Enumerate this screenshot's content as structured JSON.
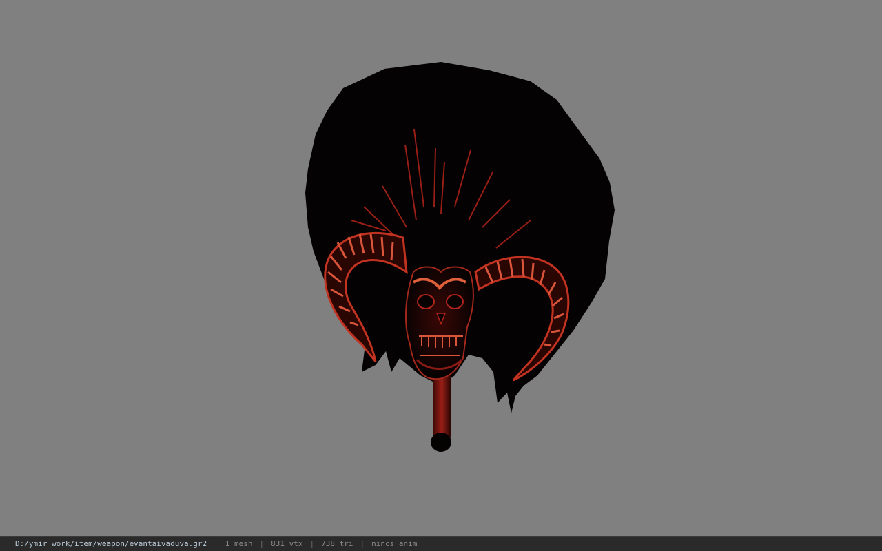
{
  "viewport": {
    "background_color": "#808080",
    "model": {
      "icon": "skull-fan-weapon-model",
      "colors": {
        "fan": "#040202",
        "accent_red": "#b3241a",
        "highlight": "#e0603a",
        "handle": "#8a1a14"
      }
    }
  },
  "status_bar": {
    "file_path": "D:/ymir work/item/weapon/evantaivaduva.gr2",
    "mesh": "1 mesh",
    "vertices": "831 vtx",
    "triangles": "738 tri",
    "animation": "nincs anim",
    "separator": "|"
  }
}
